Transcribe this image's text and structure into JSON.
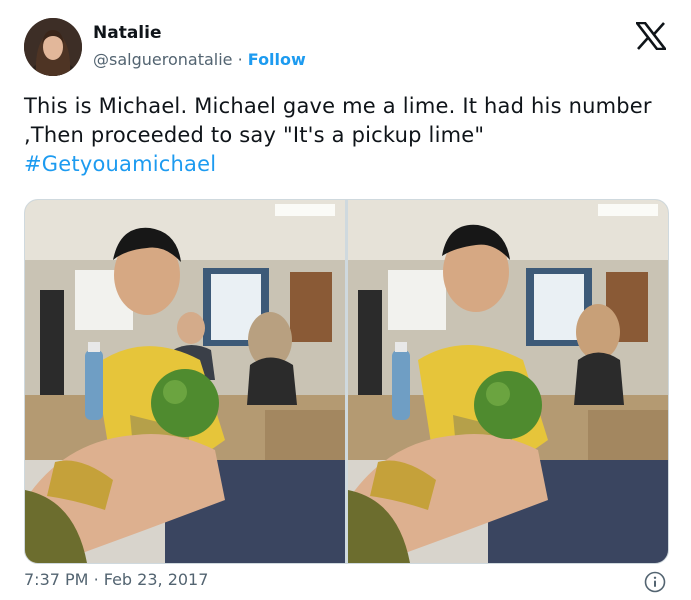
{
  "user": {
    "name": "Natalie",
    "handle": "@salgueronatalie",
    "separator": "·",
    "follow_label": "Follow"
  },
  "tweet": {
    "text_before_tag": "This is Michael. Michael gave me a lime. It had his number ,Then proceeded to say \"It's a pickup lime\" ",
    "hashtag": "#Getyouamichael"
  },
  "media": {
    "photos": [
      {
        "description_icon": "photo-classroom-lime"
      },
      {
        "description_icon": "photo-classroom-lime"
      }
    ]
  },
  "footer": {
    "time": "7:37 PM",
    "separator": "·",
    "date": "Feb 23, 2017"
  },
  "colors": {
    "accent": "#1d9bf0",
    "secondary_text": "#536471",
    "primary_text": "#0f1419"
  },
  "icons": {
    "platform": "x-logo-icon",
    "info": "info-icon"
  }
}
